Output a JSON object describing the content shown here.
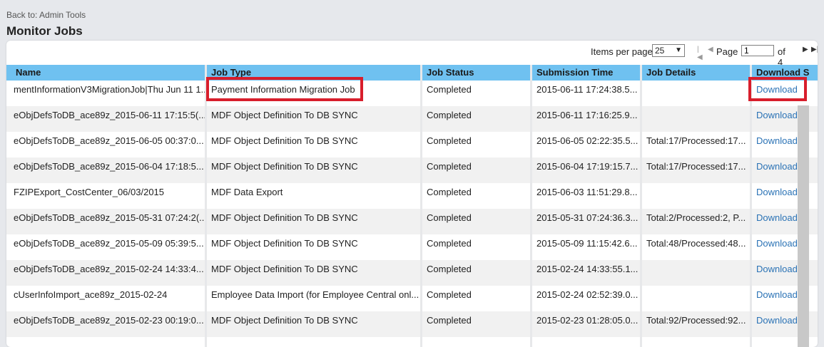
{
  "back_link": "Back to: Admin Tools",
  "title": "Monitor Jobs",
  "toolbar": {
    "items_per_page_label": "Items per page",
    "items_per_page_value": "25",
    "page_label": "Page",
    "page_value": "1",
    "of_label": "of 4"
  },
  "columns": [
    "Name",
    "Job Type",
    "Job Status",
    "Submission Time",
    "Job Details",
    "Download S"
  ],
  "rows": [
    {
      "name": "mentInformationV3MigrationJob|Thu Jun 11 1...",
      "type": "Payment Information Migration Job",
      "status": "Completed",
      "time": "2015-06-11 17:24:38.5...",
      "details": "",
      "download": "Download"
    },
    {
      "name": "eObjDefsToDB_ace89z_2015-06-11 17:15:5(...",
      "type": "MDF Object Definition To DB SYNC",
      "status": "Completed",
      "time": "2015-06-11 17:16:25.9...",
      "details": "",
      "download": "Download"
    },
    {
      "name": "eObjDefsToDB_ace89z_2015-06-05 00:37:0...",
      "type": "MDF Object Definition To DB SYNC",
      "status": "Completed",
      "time": "2015-06-05 02:22:35.5...",
      "details": "Total:17/Processed:17...",
      "download": "Download"
    },
    {
      "name": "eObjDefsToDB_ace89z_2015-06-04 17:18:5...",
      "type": "MDF Object Definition To DB SYNC",
      "status": "Completed",
      "time": "2015-06-04 17:19:15.7...",
      "details": "Total:17/Processed:17...",
      "download": "Download"
    },
    {
      "name": "FZIPExport_CostCenter_06/03/2015",
      "type": "MDF Data Export",
      "status": "Completed",
      "time": "2015-06-03 11:51:29.8...",
      "details": "",
      "download": "Download"
    },
    {
      "name": "eObjDefsToDB_ace89z_2015-05-31 07:24:2(...",
      "type": "MDF Object Definition To DB SYNC",
      "status": "Completed",
      "time": "2015-05-31 07:24:36.3...",
      "details": "Total:2/Processed:2, P...",
      "download": "Download"
    },
    {
      "name": "eObjDefsToDB_ace89z_2015-05-09 05:39:5...",
      "type": "MDF Object Definition To DB SYNC",
      "status": "Completed",
      "time": "2015-05-09 11:15:42.6...",
      "details": "Total:48/Processed:48...",
      "download": "Download"
    },
    {
      "name": "eObjDefsToDB_ace89z_2015-02-24 14:33:4...",
      "type": "MDF Object Definition To DB SYNC",
      "status": "Completed",
      "time": "2015-02-24 14:33:55.1...",
      "details": "",
      "download": "Download"
    },
    {
      "name": "cUserInfoImport_ace89z_2015-02-24",
      "type": "Employee Data Import (for Employee Central onl...",
      "status": "Completed",
      "time": "2015-02-24 02:52:39.0...",
      "details": "",
      "download": "Download"
    },
    {
      "name": "eObjDefsToDB_ace89z_2015-02-23 00:19:0...",
      "type": "MDF Object Definition To DB SYNC",
      "status": "Completed",
      "time": "2015-02-23 01:28:05.0...",
      "details": "Total:92/Processed:92...",
      "download": "Download"
    }
  ],
  "colors": {
    "header": "#6fc1f0",
    "link": "#2a72b5",
    "highlight": "#d81e2c"
  }
}
